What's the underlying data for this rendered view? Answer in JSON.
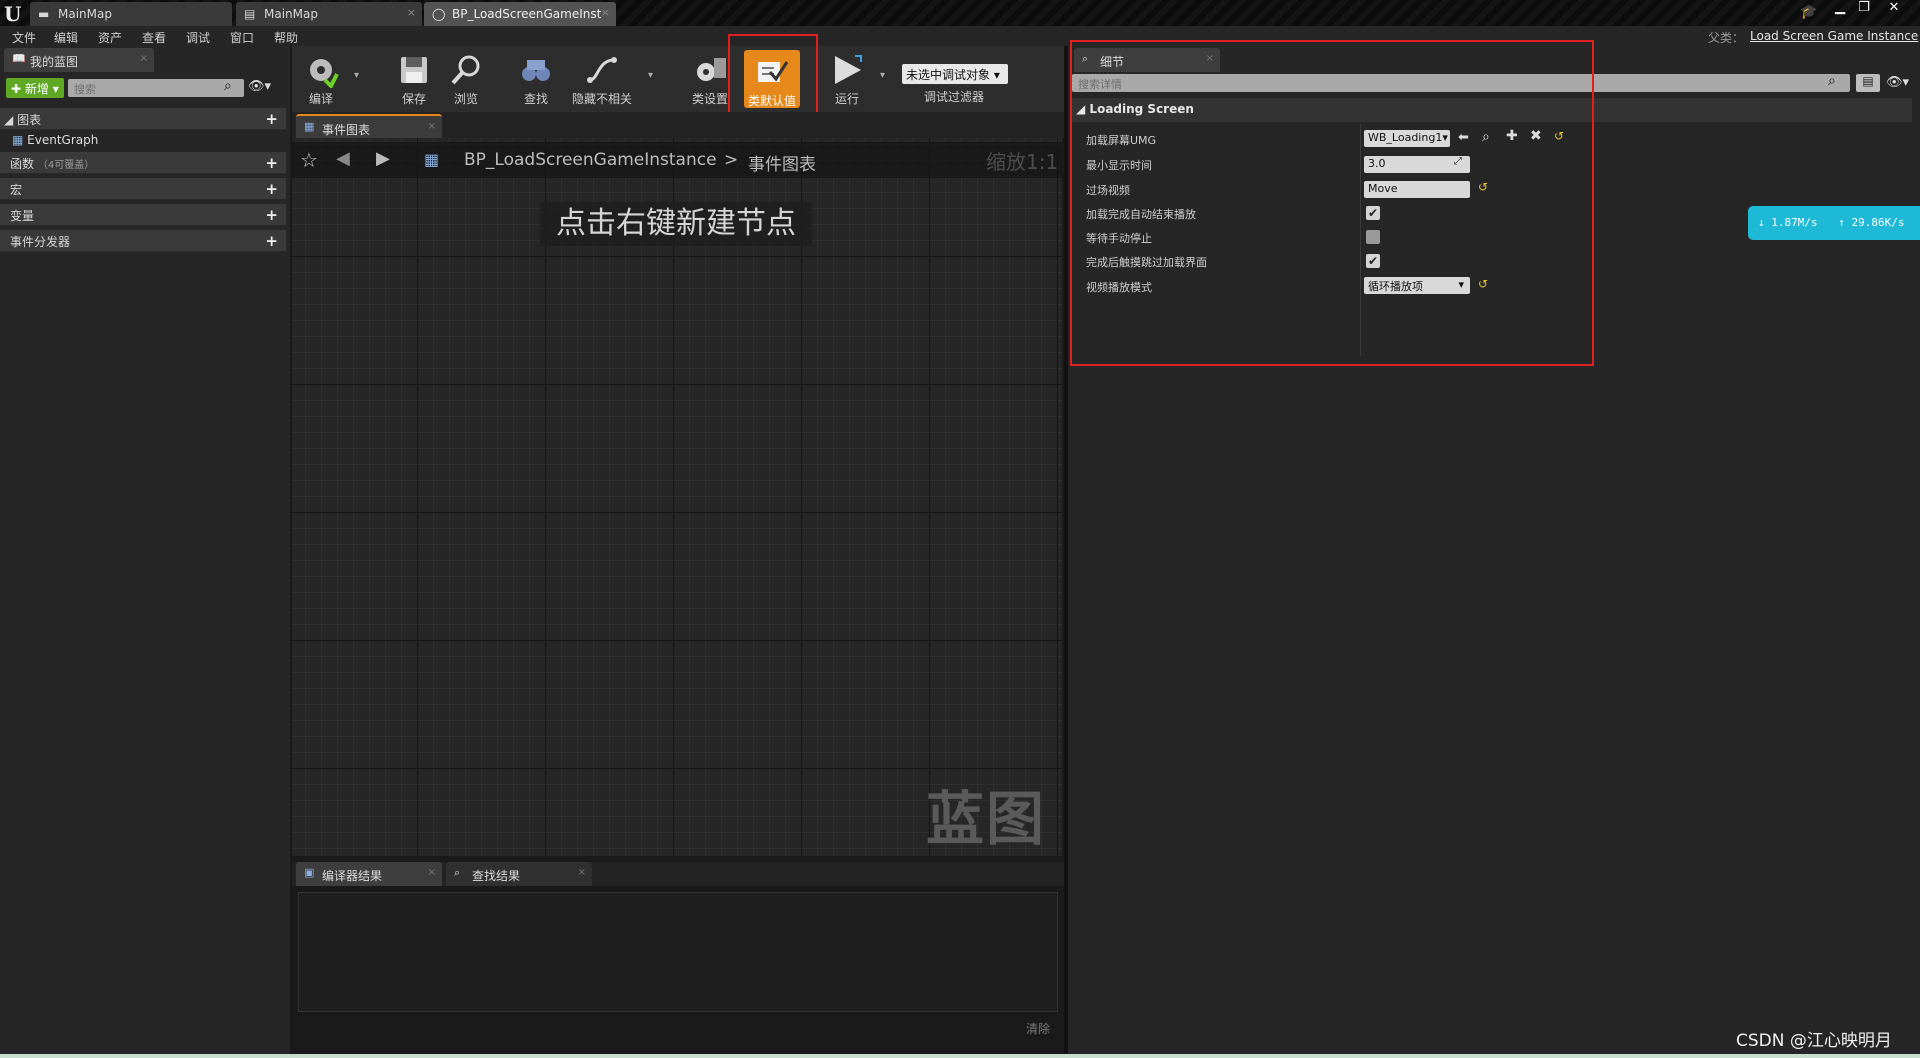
{
  "tabs": [
    {
      "label": "MainMap"
    },
    {
      "label": "MainMap"
    },
    {
      "label": "BP_LoadScreenGameInst"
    }
  ],
  "menu": [
    "文件",
    "编辑",
    "资产",
    "查看",
    "调试",
    "窗口",
    "帮助"
  ],
  "parent": {
    "label": "父类：",
    "value": "Load Screen Game Instance"
  },
  "my_blueprint": {
    "title": "我的蓝图",
    "new_label": "新增",
    "search_placeholder": "搜索",
    "sections": {
      "graphs": "图表",
      "event_graph": "EventGraph",
      "functions": "函数",
      "functions_note": "（4可覆盖）",
      "macros": "宏",
      "variables": "变量",
      "dispatchers": "事件分发器"
    }
  },
  "toolbar": {
    "compile": "编译",
    "save": "保存",
    "browse": "浏览",
    "find": "查找",
    "hide": "隐藏不相关",
    "class_settings": "类设置",
    "class_defaults": "类默认值",
    "run": "运行",
    "debug_object": "未选中调试对象",
    "debug_filter": "调试过滤器"
  },
  "graph": {
    "tab": "事件图表",
    "breadcrumb_bp": "BP_LoadScreenGameInstance",
    "breadcrumb_sep": ">",
    "breadcrumb_graph": "事件图表",
    "zoom": "缩放1:1",
    "hint": "点击右键新建节点",
    "watermark": "蓝图"
  },
  "bottom": {
    "compiler_results": "编译器结果",
    "find_results": "查找结果",
    "clear": "清除"
  },
  "details": {
    "tab": "细节",
    "search_placeholder": "搜索详情",
    "category": "Loading Screen",
    "rows": {
      "umg_label": "加载屏幕UMG",
      "umg_value": "WB_Loading1",
      "min_time_label": "最小显示时间",
      "min_time_value": "3.0",
      "video_label": "过场视频",
      "video_value": "Move",
      "autoend_label": "加载完成自动结束播放",
      "manual_label": "等待手动停止",
      "skip_label": "完成后触摸跳过加载界面",
      "mode_label": "视频播放模式",
      "mode_value": "循环播放项"
    },
    "checks": {
      "autoend": true,
      "manual": false,
      "skip": true
    }
  },
  "netspeed": {
    "down": "↓ 1.87M/s",
    "up": "↑ 29.86K/s"
  },
  "watermark_csdn": "CSDN @江心映明月",
  "colors": {
    "accent_orange": "#e6891a",
    "highlight_red": "#e02020",
    "new_green": "#5fa824",
    "net_badge": "#1fb9d8"
  }
}
